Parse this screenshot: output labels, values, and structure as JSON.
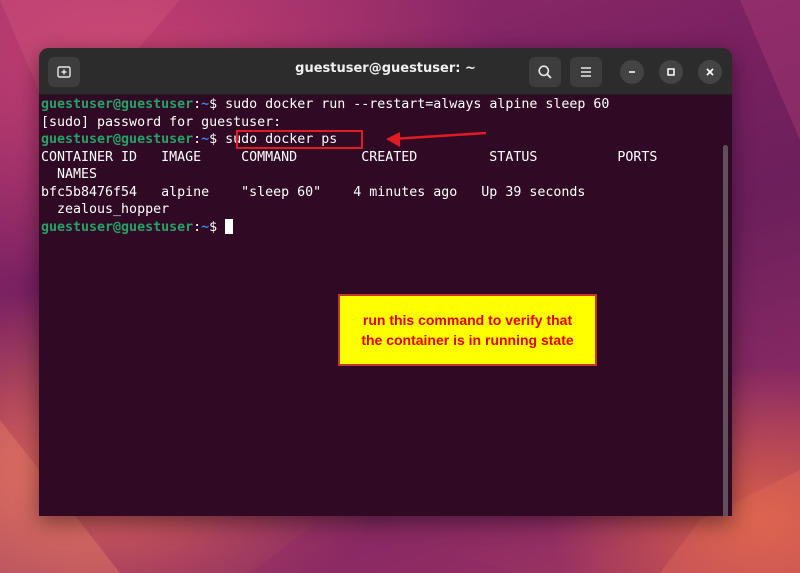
{
  "window": {
    "title": "guestuser@guestuser: ~"
  },
  "terminal": {
    "prompt": {
      "user": "guestuser@guestuser",
      "sep": ":",
      "path": "~",
      "dollar": "$ "
    },
    "lines": {
      "cmd1": "sudo docker run --restart=always alpine sleep 60",
      "sudo_prompt": "[sudo] password for guestuser:",
      "cmd2": "sudo docker ps",
      "header": "CONTAINER ID   IMAGE     COMMAND        CREATED         STATUS          PORTS",
      "header_wrap": "  NAMES",
      "row": "bfc5b8476f54   alpine    \"sleep 60\"    4 minutes ago   Up 39 seconds",
      "row_wrap": "  zealous_hopper"
    }
  },
  "annotation": {
    "line1": "run this command to verify that",
    "line2": "the container is in running state"
  },
  "colors": {
    "prompt_user": "#26a269",
    "prompt_path": "#3584e4",
    "highlight": "#e01b24",
    "note_bg": "#ffff00",
    "note_text": "#e00000"
  }
}
